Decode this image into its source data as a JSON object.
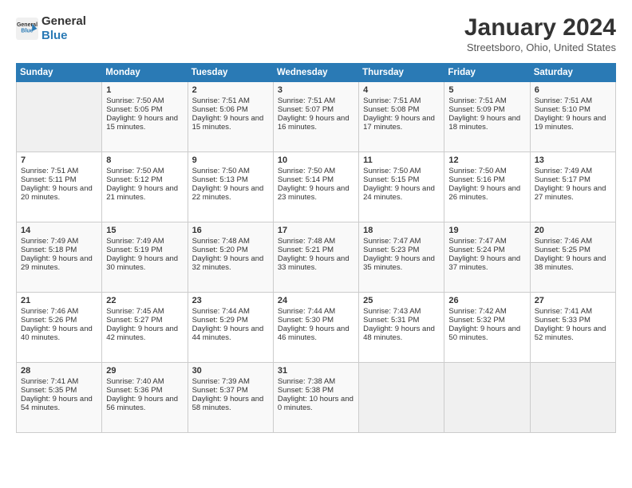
{
  "logo": {
    "line1": "General",
    "line2": "Blue"
  },
  "title": "January 2024",
  "location": "Streetsboro, Ohio, United States",
  "days_of_week": [
    "Sunday",
    "Monday",
    "Tuesday",
    "Wednesday",
    "Thursday",
    "Friday",
    "Saturday"
  ],
  "weeks": [
    [
      {
        "day": "",
        "sunrise": "",
        "sunset": "",
        "daylight": ""
      },
      {
        "day": "1",
        "sunrise": "Sunrise: 7:50 AM",
        "sunset": "Sunset: 5:05 PM",
        "daylight": "Daylight: 9 hours and 15 minutes."
      },
      {
        "day": "2",
        "sunrise": "Sunrise: 7:51 AM",
        "sunset": "Sunset: 5:06 PM",
        "daylight": "Daylight: 9 hours and 15 minutes."
      },
      {
        "day": "3",
        "sunrise": "Sunrise: 7:51 AM",
        "sunset": "Sunset: 5:07 PM",
        "daylight": "Daylight: 9 hours and 16 minutes."
      },
      {
        "day": "4",
        "sunrise": "Sunrise: 7:51 AM",
        "sunset": "Sunset: 5:08 PM",
        "daylight": "Daylight: 9 hours and 17 minutes."
      },
      {
        "day": "5",
        "sunrise": "Sunrise: 7:51 AM",
        "sunset": "Sunset: 5:09 PM",
        "daylight": "Daylight: 9 hours and 18 minutes."
      },
      {
        "day": "6",
        "sunrise": "Sunrise: 7:51 AM",
        "sunset": "Sunset: 5:10 PM",
        "daylight": "Daylight: 9 hours and 19 minutes."
      }
    ],
    [
      {
        "day": "7",
        "sunrise": "Sunrise: 7:51 AM",
        "sunset": "Sunset: 5:11 PM",
        "daylight": "Daylight: 9 hours and 20 minutes."
      },
      {
        "day": "8",
        "sunrise": "Sunrise: 7:50 AM",
        "sunset": "Sunset: 5:12 PM",
        "daylight": "Daylight: 9 hours and 21 minutes."
      },
      {
        "day": "9",
        "sunrise": "Sunrise: 7:50 AM",
        "sunset": "Sunset: 5:13 PM",
        "daylight": "Daylight: 9 hours and 22 minutes."
      },
      {
        "day": "10",
        "sunrise": "Sunrise: 7:50 AM",
        "sunset": "Sunset: 5:14 PM",
        "daylight": "Daylight: 9 hours and 23 minutes."
      },
      {
        "day": "11",
        "sunrise": "Sunrise: 7:50 AM",
        "sunset": "Sunset: 5:15 PM",
        "daylight": "Daylight: 9 hours and 24 minutes."
      },
      {
        "day": "12",
        "sunrise": "Sunrise: 7:50 AM",
        "sunset": "Sunset: 5:16 PM",
        "daylight": "Daylight: 9 hours and 26 minutes."
      },
      {
        "day": "13",
        "sunrise": "Sunrise: 7:49 AM",
        "sunset": "Sunset: 5:17 PM",
        "daylight": "Daylight: 9 hours and 27 minutes."
      }
    ],
    [
      {
        "day": "14",
        "sunrise": "Sunrise: 7:49 AM",
        "sunset": "Sunset: 5:18 PM",
        "daylight": "Daylight: 9 hours and 29 minutes."
      },
      {
        "day": "15",
        "sunrise": "Sunrise: 7:49 AM",
        "sunset": "Sunset: 5:19 PM",
        "daylight": "Daylight: 9 hours and 30 minutes."
      },
      {
        "day": "16",
        "sunrise": "Sunrise: 7:48 AM",
        "sunset": "Sunset: 5:20 PM",
        "daylight": "Daylight: 9 hours and 32 minutes."
      },
      {
        "day": "17",
        "sunrise": "Sunrise: 7:48 AM",
        "sunset": "Sunset: 5:21 PM",
        "daylight": "Daylight: 9 hours and 33 minutes."
      },
      {
        "day": "18",
        "sunrise": "Sunrise: 7:47 AM",
        "sunset": "Sunset: 5:23 PM",
        "daylight": "Daylight: 9 hours and 35 minutes."
      },
      {
        "day": "19",
        "sunrise": "Sunrise: 7:47 AM",
        "sunset": "Sunset: 5:24 PM",
        "daylight": "Daylight: 9 hours and 37 minutes."
      },
      {
        "day": "20",
        "sunrise": "Sunrise: 7:46 AM",
        "sunset": "Sunset: 5:25 PM",
        "daylight": "Daylight: 9 hours and 38 minutes."
      }
    ],
    [
      {
        "day": "21",
        "sunrise": "Sunrise: 7:46 AM",
        "sunset": "Sunset: 5:26 PM",
        "daylight": "Daylight: 9 hours and 40 minutes."
      },
      {
        "day": "22",
        "sunrise": "Sunrise: 7:45 AM",
        "sunset": "Sunset: 5:27 PM",
        "daylight": "Daylight: 9 hours and 42 minutes."
      },
      {
        "day": "23",
        "sunrise": "Sunrise: 7:44 AM",
        "sunset": "Sunset: 5:29 PM",
        "daylight": "Daylight: 9 hours and 44 minutes."
      },
      {
        "day": "24",
        "sunrise": "Sunrise: 7:44 AM",
        "sunset": "Sunset: 5:30 PM",
        "daylight": "Daylight: 9 hours and 46 minutes."
      },
      {
        "day": "25",
        "sunrise": "Sunrise: 7:43 AM",
        "sunset": "Sunset: 5:31 PM",
        "daylight": "Daylight: 9 hours and 48 minutes."
      },
      {
        "day": "26",
        "sunrise": "Sunrise: 7:42 AM",
        "sunset": "Sunset: 5:32 PM",
        "daylight": "Daylight: 9 hours and 50 minutes."
      },
      {
        "day": "27",
        "sunrise": "Sunrise: 7:41 AM",
        "sunset": "Sunset: 5:33 PM",
        "daylight": "Daylight: 9 hours and 52 minutes."
      }
    ],
    [
      {
        "day": "28",
        "sunrise": "Sunrise: 7:41 AM",
        "sunset": "Sunset: 5:35 PM",
        "daylight": "Daylight: 9 hours and 54 minutes."
      },
      {
        "day": "29",
        "sunrise": "Sunrise: 7:40 AM",
        "sunset": "Sunset: 5:36 PM",
        "daylight": "Daylight: 9 hours and 56 minutes."
      },
      {
        "day": "30",
        "sunrise": "Sunrise: 7:39 AM",
        "sunset": "Sunset: 5:37 PM",
        "daylight": "Daylight: 9 hours and 58 minutes."
      },
      {
        "day": "31",
        "sunrise": "Sunrise: 7:38 AM",
        "sunset": "Sunset: 5:38 PM",
        "daylight": "Daylight: 10 hours and 0 minutes."
      },
      {
        "day": "",
        "sunrise": "",
        "sunset": "",
        "daylight": ""
      },
      {
        "day": "",
        "sunrise": "",
        "sunset": "",
        "daylight": ""
      },
      {
        "day": "",
        "sunrise": "",
        "sunset": "",
        "daylight": ""
      }
    ]
  ],
  "colors": {
    "header_bg": "#2a7ab5",
    "header_text": "#ffffff",
    "border": "#cccccc"
  }
}
